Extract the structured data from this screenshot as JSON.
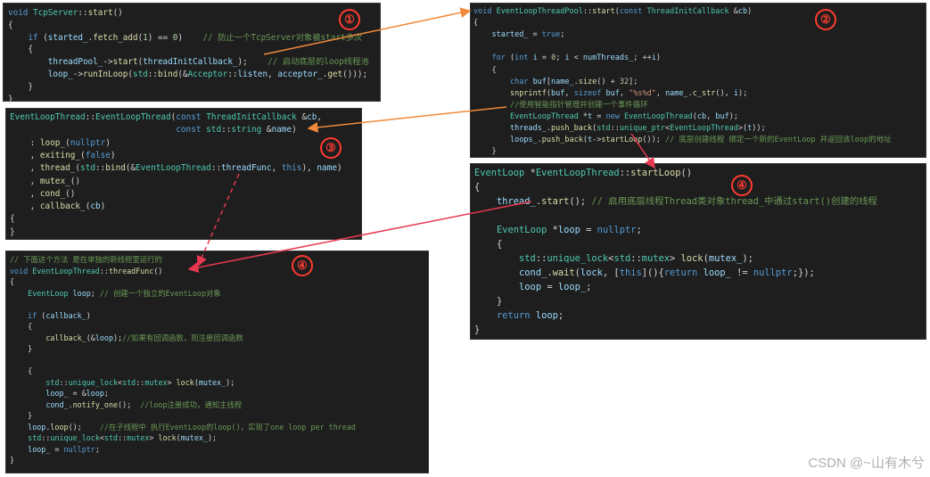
{
  "panel1": {
    "badge": "①",
    "lines": [
      "void TcpServer::start()",
      "{",
      "    if (started_.fetch_add(1) == 0)    // 防止一个TcpServer对象被start多次",
      "    {",
      "        threadPool_->start(threadInitCallback_);    // 启动底层的loop线程池",
      "        loop_->runInLoop(std::bind(&Acceptor::listen, acceptor_.get()));",
      "    }",
      "}"
    ]
  },
  "panel2": {
    "badge": "②",
    "lines": [
      "void EventLoopThreadPool::start(const ThreadInitCallback &cb)",
      "{",
      "    started_ = true;",
      "",
      "    for (int i = 0; i < numThreads_; ++i)",
      "    {",
      "        char buf[name_.size() + 32];",
      "        snprintf(buf, sizeof buf, \"%s%d\", name_.c_str(), i);",
      "        //使用智能指针管理并创建一个事件循环",
      "        EventLoopThread *t = new EventLoopThread(cb, buf);",
      "        threads_.push_back(std::unique_ptr<EventLoopThread>(t));",
      "        loops_.push_back(t->startLoop()); // 底层创建线程 绑定一个新的EventLoop 并返回该loop的地址",
      "    }"
    ]
  },
  "panel3": {
    "badge": "③",
    "lines": [
      "EventLoopThread::EventLoopThread(const ThreadInitCallback &cb,",
      "                                 const std::string &name)",
      "    : loop_(nullptr)",
      "    , exiting_(false)",
      "    , thread_(std::bind(&EventLoopThread::threadFunc, this), name)",
      "    , mutex_()",
      "    , cond_()",
      "    , callback_(cb)",
      "{",
      "}"
    ]
  },
  "panel4": {
    "badge": "④",
    "lines": [
      "EventLoop *EventLoopThread::startLoop()",
      "{",
      "    thread_.start(); // 启用底层线程Thread类对象thread_中通过start()创建的线程",
      "",
      "    EventLoop *loop = nullptr;",
      "    {",
      "        std::unique_lock<std::mutex> lock(mutex_);",
      "        cond_.wait(lock, [this](){return loop_ != nullptr;});",
      "        loop = loop_;",
      "    }",
      "    return loop;",
      "}"
    ]
  },
  "panel5": {
    "badge": "④",
    "lines": [
      "// 下面这个方法 是在单独的新线程里运行的",
      "void EventLoopThread::threadFunc()",
      "{",
      "    EventLoop loop; // 创建一个独立的EventLoop对象",
      "",
      "    if (callback_)",
      "    {",
      "        callback_(&loop);//如果有回调函数，则注册回调函数",
      "    }",
      "",
      "    {",
      "        std::unique_lock<std::mutex> lock(mutex_);",
      "        loop_ = &loop;",
      "        cond_.notify_one();  //loop注册成功，通知主线程",
      "    }",
      "    loop.loop();    //在子线程中 执行EventLoop的loop()，实现了one loop per thread",
      "    std::unique_lock<std::mutex> lock(mutex_);",
      "    loop_ = nullptr;",
      "}"
    ]
  },
  "watermark": "CSDN @~山有木兮",
  "colors": {
    "arrow_orange": "#f08a3a",
    "arrow_red": "#e8384f",
    "badge_red": "#ff3b30",
    "bg": "#1e1e1e"
  }
}
